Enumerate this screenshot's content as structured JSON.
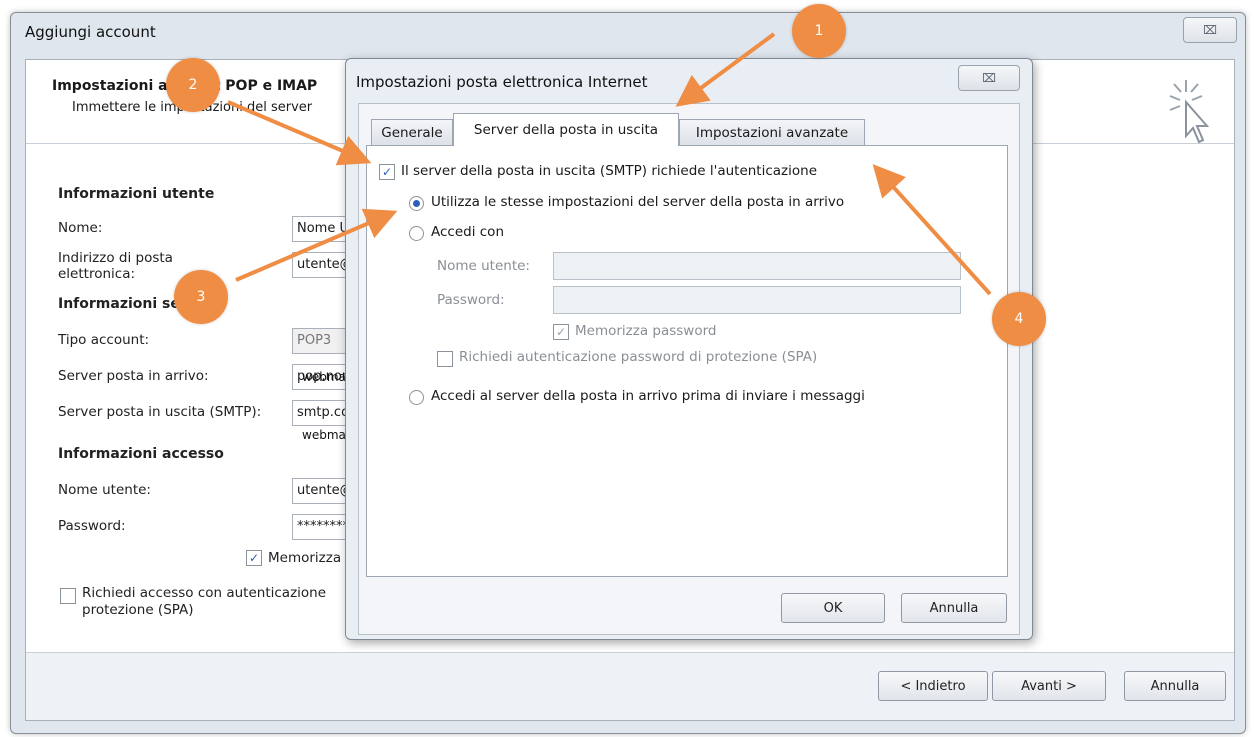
{
  "outer": {
    "title": "Aggiungi account",
    "close_glyph": "⌧",
    "header_title": "Impostazioni account POP e IMAP",
    "header_subtitle": "Immettere le impostazioni del server",
    "sections": {
      "user_info": "Informazioni utente",
      "server_info": "Informazioni ser",
      "access_info": "Informazioni accesso"
    },
    "labels": {
      "name": "Nome:",
      "email": "Indirizzo di posta\nelettronica:",
      "account_type": "Tipo account:",
      "incoming": "Server posta in arrivo:",
      "outgoing": "Server posta in uscita (SMTP):",
      "username": "Nome utente:",
      "password": "Password:",
      "remember": "Memorizza",
      "spa": "Richiedi accesso con autenticazione\nprotezione (SPA)"
    },
    "values": {
      "name": "Nome U",
      "email": "utente@",
      "account_type": "POP3",
      "incoming": "pop.nom",
      "incoming_overlay": "webma",
      "outgoing": "smtp.co",
      "outgoing_overlay": "webma",
      "username": "utente@",
      "password": "*********"
    },
    "buttons": {
      "back": "< Indietro",
      "next": "Avanti >",
      "cancel": "Annulla"
    }
  },
  "dialog": {
    "title": "Impostazioni posta elettronica Internet",
    "close_glyph": "⌧",
    "tabs": [
      "Generale",
      "Server della posta in uscita",
      "Impostazioni avanzate"
    ],
    "active_tab": 1,
    "smtp_auth_label": "Il server della posta in uscita (SMTP) richiede l'autenticazione",
    "same_settings_label": "Utilizza le stesse impostazioni del server della posta in arrivo",
    "login_with_label": "Accedi con",
    "username_label": "Nome utente:",
    "password_label": "Password:",
    "remember_label": "Memorizza password",
    "spa_label": "Richiedi autenticazione password di protezione (SPA)",
    "login_before_label": "Accedi al server della posta in arrivo prima di inviare i messaggi",
    "ok": "OK",
    "cancel": "Annulla",
    "check_glyph": "✓"
  },
  "annotations": [
    "1",
    "2",
    "3",
    "4"
  ],
  "colors": {
    "annotation": "#ef8d44",
    "accent": "#2e5fb8"
  }
}
